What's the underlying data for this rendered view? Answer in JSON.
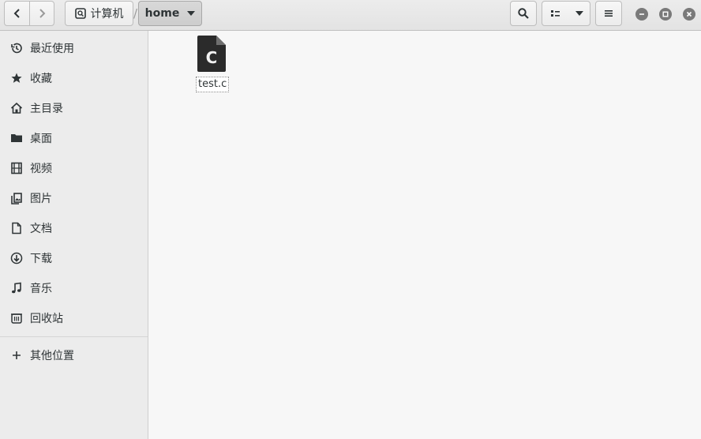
{
  "header": {
    "location_computer": "计算机",
    "separator": "/",
    "location_current": "home"
  },
  "sidebar": {
    "items": [
      {
        "label": "最近使用",
        "icon": "recent-icon"
      },
      {
        "label": "收藏",
        "icon": "star-icon"
      },
      {
        "label": "主目录",
        "icon": "home-icon"
      },
      {
        "label": "桌面",
        "icon": "folder-icon"
      },
      {
        "label": "视频",
        "icon": "film-icon"
      },
      {
        "label": "图片",
        "icon": "picture-icon"
      },
      {
        "label": "文档",
        "icon": "document-icon"
      },
      {
        "label": "下载",
        "icon": "download-icon"
      },
      {
        "label": "音乐",
        "icon": "music-icon"
      },
      {
        "label": "回收站",
        "icon": "trash-icon"
      },
      {
        "label": "其他位置",
        "icon": "plus-icon"
      }
    ]
  },
  "files": [
    {
      "name": "test.c",
      "icon": "c-source-file-icon",
      "icon_letter": "C"
    }
  ]
}
